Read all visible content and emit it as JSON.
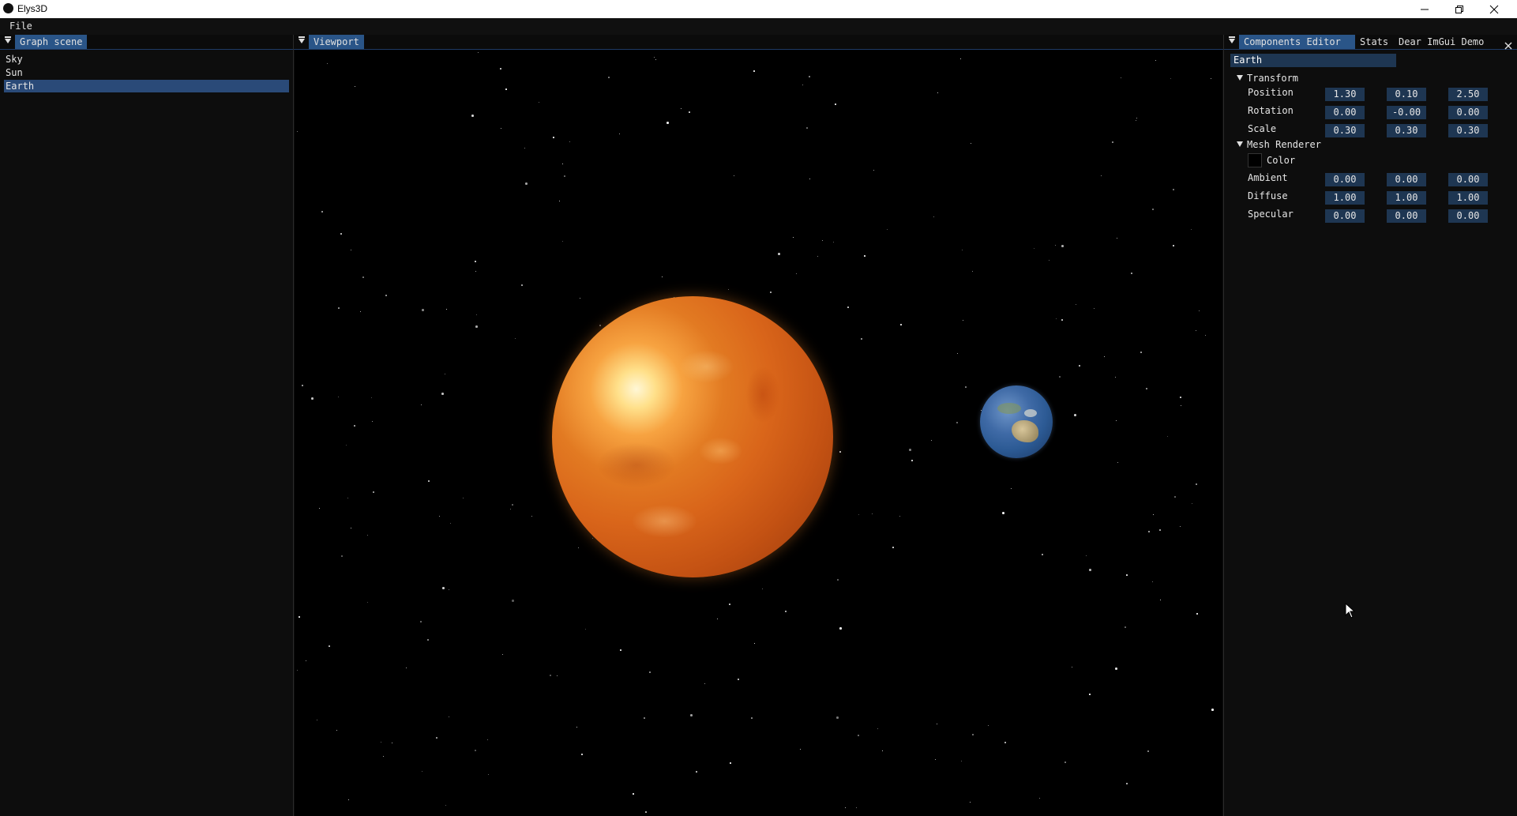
{
  "window": {
    "title": "Elys3D"
  },
  "menu": {
    "file": "File"
  },
  "graph_scene": {
    "tab": "Graph scene",
    "items": [
      {
        "label": "Sky"
      },
      {
        "label": "Sun"
      },
      {
        "label": "Earth"
      }
    ],
    "selected": "Earth"
  },
  "viewport": {
    "tab": "Viewport"
  },
  "right_panel": {
    "tabs": [
      {
        "label": "Components Editor"
      },
      {
        "label": "Stats"
      },
      {
        "label": "Dear ImGui Demo"
      }
    ],
    "entity_name": "Earth",
    "transform": {
      "header": "Transform",
      "position": {
        "label": "Position",
        "values": [
          "1.30",
          "0.10",
          "2.50"
        ]
      },
      "rotation": {
        "label": "Rotation",
        "values": [
          "0.00",
          "-0.00",
          "0.00"
        ]
      },
      "scale": {
        "label": "Scale",
        "values": [
          "0.30",
          "0.30",
          "0.30"
        ]
      }
    },
    "mesh_renderer": {
      "header": "Mesh Renderer",
      "color_label": "Color",
      "color_value": "#000000",
      "ambient": {
        "label": "Ambient",
        "values": [
          "0.00",
          "0.00",
          "0.00"
        ]
      },
      "diffuse": {
        "label": "Diffuse",
        "values": [
          "1.00",
          "1.00",
          "1.00"
        ]
      },
      "specular": {
        "label": "Specular",
        "values": [
          "0.00",
          "0.00",
          "0.00"
        ]
      }
    }
  },
  "colors": {
    "accent": "#2a5588",
    "field_bg": "#1e3652",
    "panel_bg": "#0d0d0d"
  }
}
